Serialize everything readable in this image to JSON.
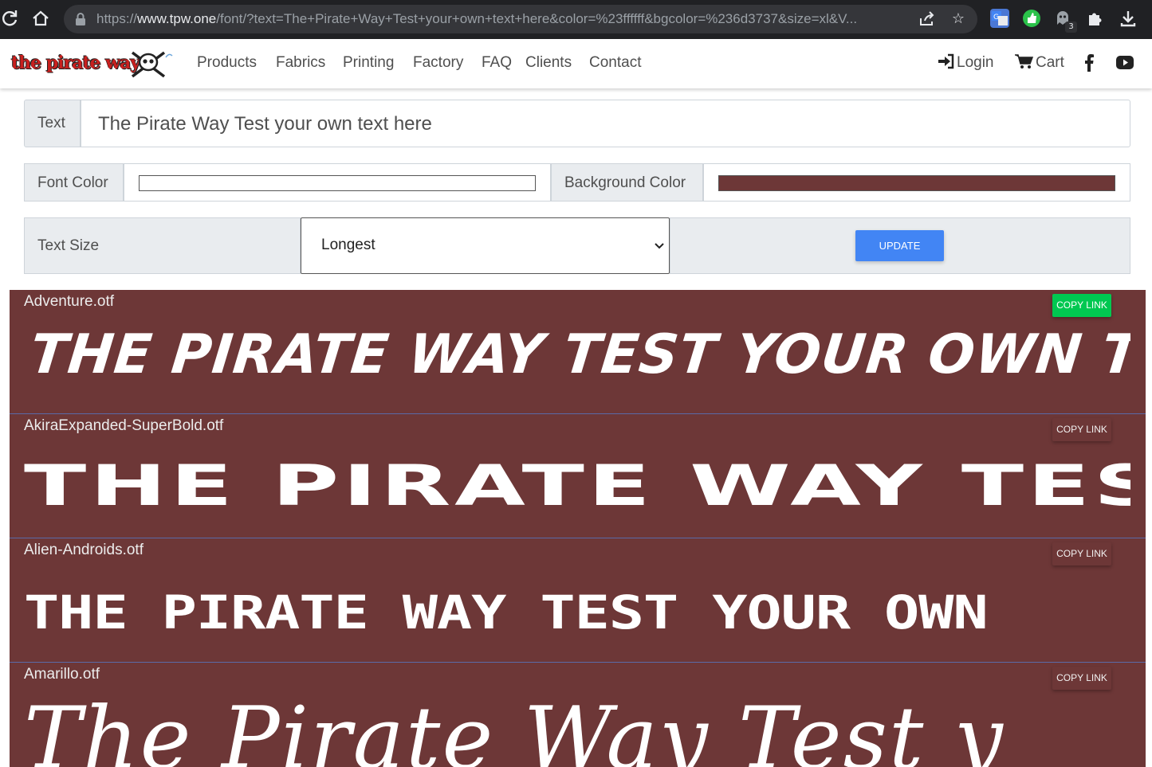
{
  "browser": {
    "url_prefix": "https://",
    "url_host": "www.tpw.one",
    "url_rest": "/font/?text=The+Pirate+Way+Test+your+own+text+here&color=%23ffffff&bgcolor=%236d3737&size=xl&V...",
    "extension_badge": "3"
  },
  "nav": {
    "logo_text": "the pirate way",
    "items": [
      "Products",
      "Fabrics",
      "Printing",
      "Factory",
      "FAQ",
      "Clients",
      "Contact"
    ],
    "login": "Login",
    "cart": "Cart"
  },
  "form": {
    "text_label": "Text",
    "text_value": "The Pirate Way Test your own text here",
    "font_color_label": "Font Color",
    "font_color_value": "#ffffff",
    "bg_color_label": "Background Color",
    "bg_color_value": "#6d3737",
    "size_label": "Text Size",
    "size_value": "Longest",
    "update_label": "UPDATE"
  },
  "fonts": [
    {
      "name": "Adventure.otf",
      "sample": "THE PIRATE WAY TEST YOUR OWN TEXT H",
      "copy_label": "COPY LINK",
      "copy_active": true
    },
    {
      "name": "AkiraExpanded-SuperBold.otf",
      "sample": "THE PIRATE WAY TEST",
      "copy_label": "COPY LINK",
      "copy_active": false
    },
    {
      "name": "Alien-Androids.otf",
      "sample": "THE PIRATE WAY TEST YOUR OWN",
      "copy_label": "COPY LINK",
      "copy_active": false
    },
    {
      "name": "Amarillo.otf",
      "sample": "The Pirate Way Test y",
      "copy_label": "COPY LINK",
      "copy_active": false
    }
  ],
  "colors": {
    "panel_bg": "#6d3737",
    "accent_blue": "#4285f4",
    "copy_green": "#00c851"
  }
}
